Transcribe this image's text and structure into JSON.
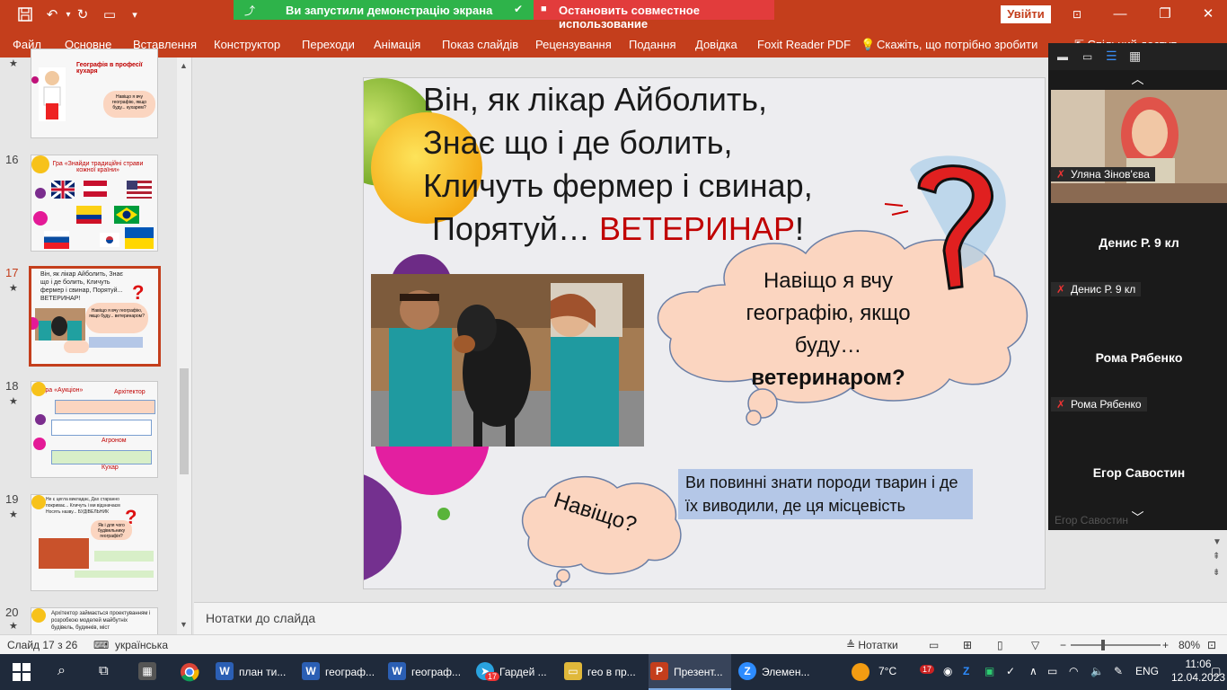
{
  "titlebar": {
    "share_status": "Ви запустили демонстрацію экрана",
    "stop_share": "Остановить совместное использование",
    "signin": "Увійти"
  },
  "ribbon": {
    "tabs": [
      "Файл",
      "Основне",
      "Вставлення",
      "Конструктор",
      "Переходи",
      "Анімація",
      "Показ слайдів",
      "Рецензування",
      "Подання",
      "Довідка",
      "Foxit Reader PDF",
      "Скажіть, що потрібно зробити",
      "Спільний доступ"
    ]
  },
  "thumbnails": {
    "items": [
      {
        "num": "",
        "title": "Географія в професії кухаря",
        "text": "Навіщо я вчу географію, якщо буду... кухарем?"
      },
      {
        "num": "16",
        "title": "Гра «Знайди традиційні страви кожної країни»"
      },
      {
        "num": "17",
        "title": "Він, як лікар Айболить, Знає що і де болить, Кличуть фермер і свинар, Порятуй... ВЕТЕРИНАР!",
        "text": "Навіщо я вчу географію, якщо буду... ветеринаром?"
      },
      {
        "num": "18",
        "title": "Гра «Аукціон»",
        "label1": "Архітектор",
        "label2": "Агроном",
        "label3": "Кухар"
      },
      {
        "num": "19",
        "title": "Не є цегла викладає, Дах старанно покриває... Кличуть і ми відзначаєм Носять назву... БУДІВЕЛЬНИК",
        "text": "Як і для чого будівельнику географія?"
      },
      {
        "num": "20",
        "title": "Архітектор займається проектуванням і розробкою моделей майбутніх будівель, будинків, міст"
      }
    ]
  },
  "slide": {
    "poem": {
      "line1": "Він, як лікар Айболить,",
      "line2": "Знає що і де болить,",
      "line3": "Кличуть фермер і свинар,",
      "line4_prefix": " Порятуй… ",
      "line4_highlight": "ВЕТЕРИНАР",
      "line4_suffix": "!"
    },
    "cloud_question": {
      "line1": "Навіщо я вчу",
      "line2": "географію, якщо",
      "line3_prefix": "буду… ",
      "line3_bold": "ветеринаром?"
    },
    "why": "Навіщо?",
    "info": "Ви повинні знати породи тварин і де їх виводили, де ця місцевість"
  },
  "notes": {
    "placeholder": "Нотатки до слайда"
  },
  "statusbar": {
    "slide_info": "Слайд 17 з 26",
    "language": "українська",
    "notes_btn": "Нотатки",
    "zoom": "80%"
  },
  "video": {
    "participants": [
      {
        "name": "Уляна Зінов'єва",
        "has_video": true
      },
      {
        "name": "Денис Р. 9 кл",
        "has_video": false
      },
      {
        "name": "Рома Рябенко",
        "has_video": false
      },
      {
        "name": "Егор Савостин",
        "has_video": false
      }
    ]
  },
  "taskbar": {
    "apps": [
      {
        "label": "план ти...",
        "icon": "W",
        "color": "#2b5fb4"
      },
      {
        "label": "географ...",
        "icon": "W",
        "color": "#2b5fb4"
      },
      {
        "label": "географ...",
        "icon": "W",
        "color": "#2b5fb4"
      },
      {
        "label": "Гардей ...",
        "icon": "T",
        "color": "#2aa3df"
      },
      {
        "label": "гео в пр...",
        "icon": "F",
        "color": "#e0b83a"
      },
      {
        "label": "Презент...",
        "icon": "P",
        "color": "#c43e1c"
      },
      {
        "label": "Элемен...",
        "icon": "Z",
        "color": "#2d8cff"
      }
    ],
    "weather": "7°C",
    "lang": "ENG",
    "time": "11:06",
    "date": "12.04.2023",
    "badge": "17"
  }
}
